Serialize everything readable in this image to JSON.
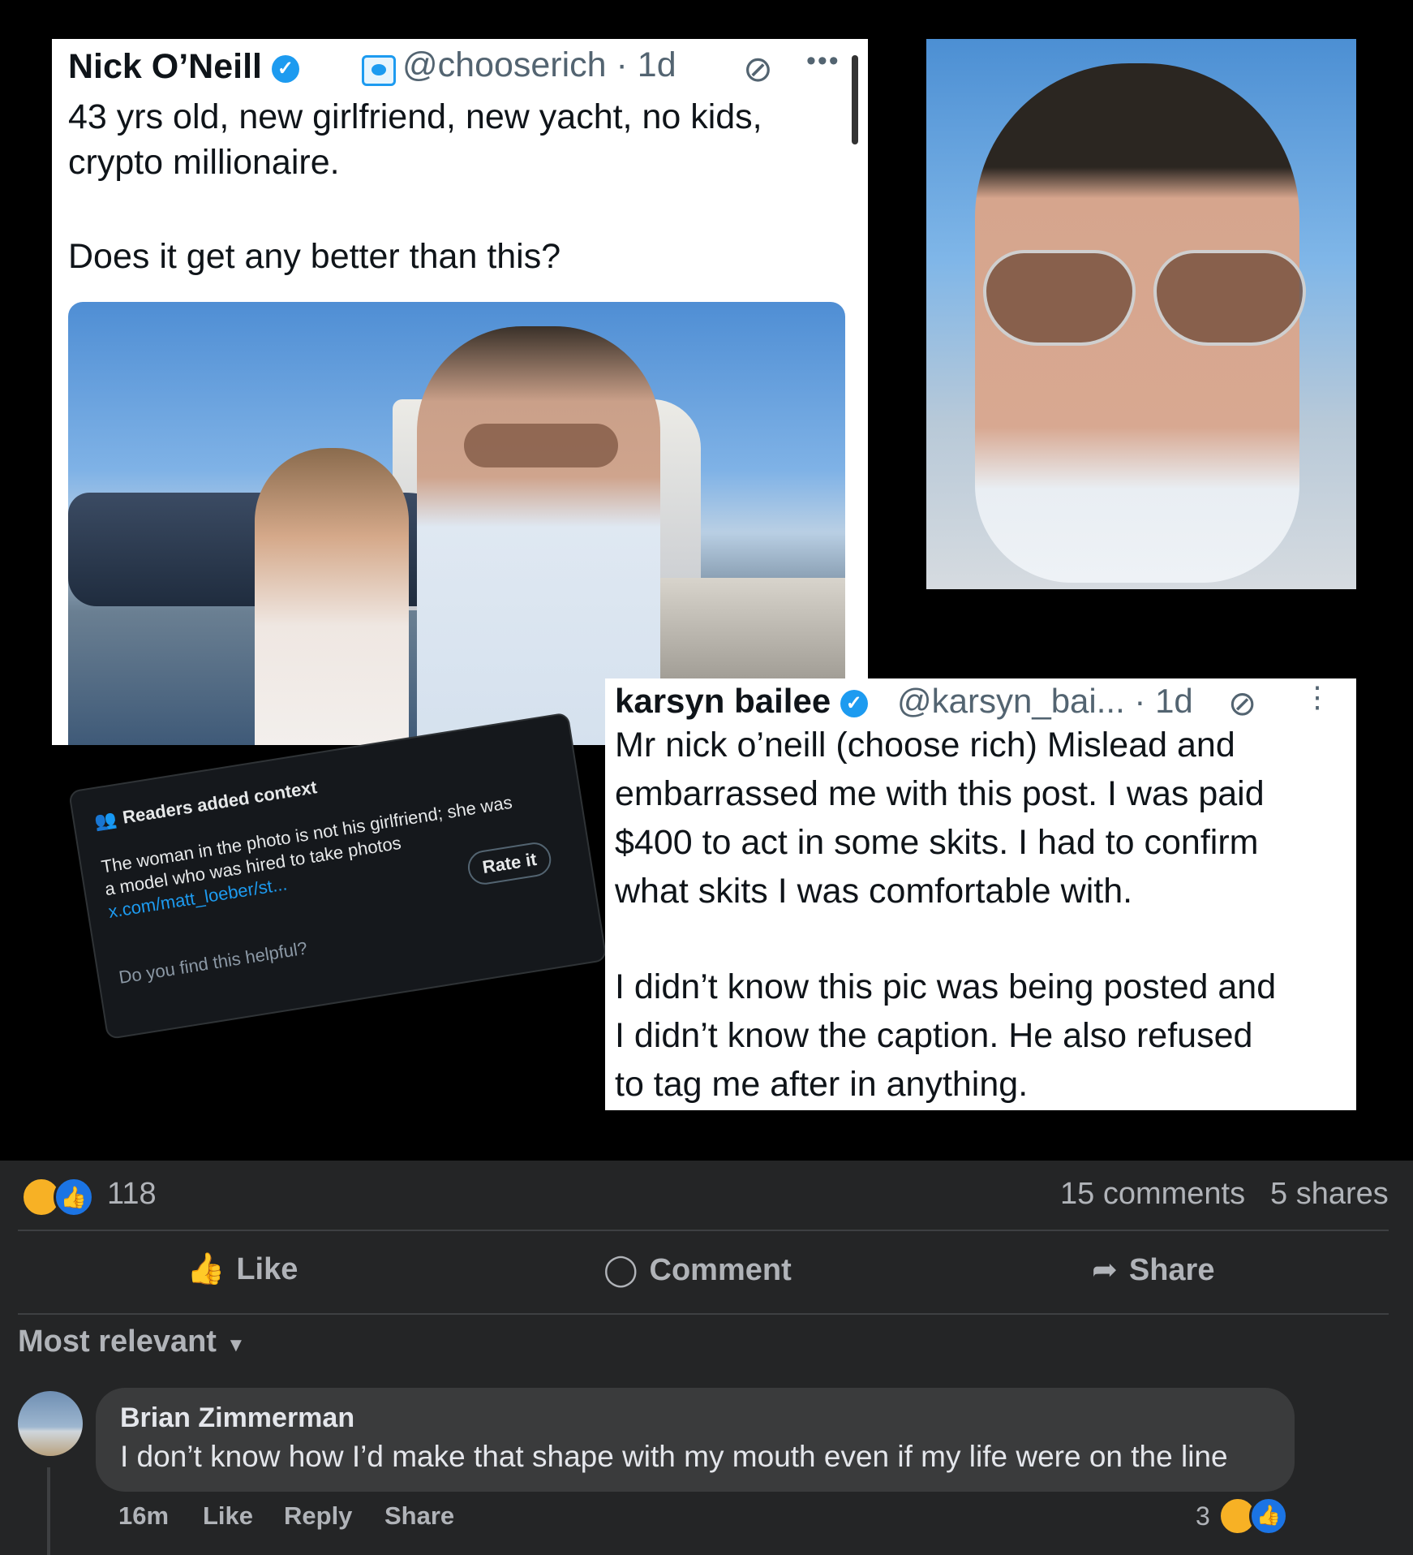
{
  "tweet1": {
    "name": "Nick O’Neill",
    "handle_time": "@chooserich · 1d",
    "line1": "43 yrs old, new girlfriend, new yacht, no kids,",
    "line2": "crypto millionaire.",
    "line3": "Does it get any better than this?"
  },
  "note": {
    "header": "Readers added context",
    "body1": "The woman in the photo is not his girlfriend; she was",
    "body2": "a model who was hired to take photos",
    "link": "x.com/matt_loeber/st...",
    "rate": "Rate it",
    "question": "Do you find this helpful?"
  },
  "tweet2": {
    "name": "karsyn bailee",
    "handle_time": "@karsyn_bai... · 1d",
    "lines": [
      "Mr nick o’neill (choose rich) Mislead and",
      "embarrassed me with this post. I was paid",
      "$400 to act in some skits. I had to confirm",
      "what skits I was comfortable with.",
      "I didn’t know this pic was being posted and",
      "I didn’t know the caption. He also refused",
      "to tag me after in anything."
    ]
  },
  "post": {
    "reaction_count": "118",
    "comments": "15 comments",
    "shares": "5 shares",
    "like_label": "Like",
    "comment_label": "Comment",
    "share_label": "Share",
    "sort_label": "Most relevant"
  },
  "comment": {
    "author": "Brian Zimmerman",
    "text": "I don’t know how I’d make that shape with my mouth even if my life were on the line",
    "time": "16m",
    "like": "Like",
    "reply": "Reply",
    "share": "Share",
    "reaction_count": "3"
  },
  "icons": {
    "verified": "verified-check-icon",
    "grok": "grok-icon",
    "more": "more-icon",
    "haha": "haha-reaction-icon",
    "like": "like-reaction-icon",
    "thumb": "thumbs-up-icon",
    "comment": "comment-bubble-icon",
    "share": "share-arrow-icon",
    "caret": "caret-down-icon"
  },
  "colors": {
    "facebook_bg": "#242526",
    "twitter_blue": "#1d9bf0",
    "fb_blue": "#1b74e4",
    "haha_yellow": "#f7b125"
  }
}
